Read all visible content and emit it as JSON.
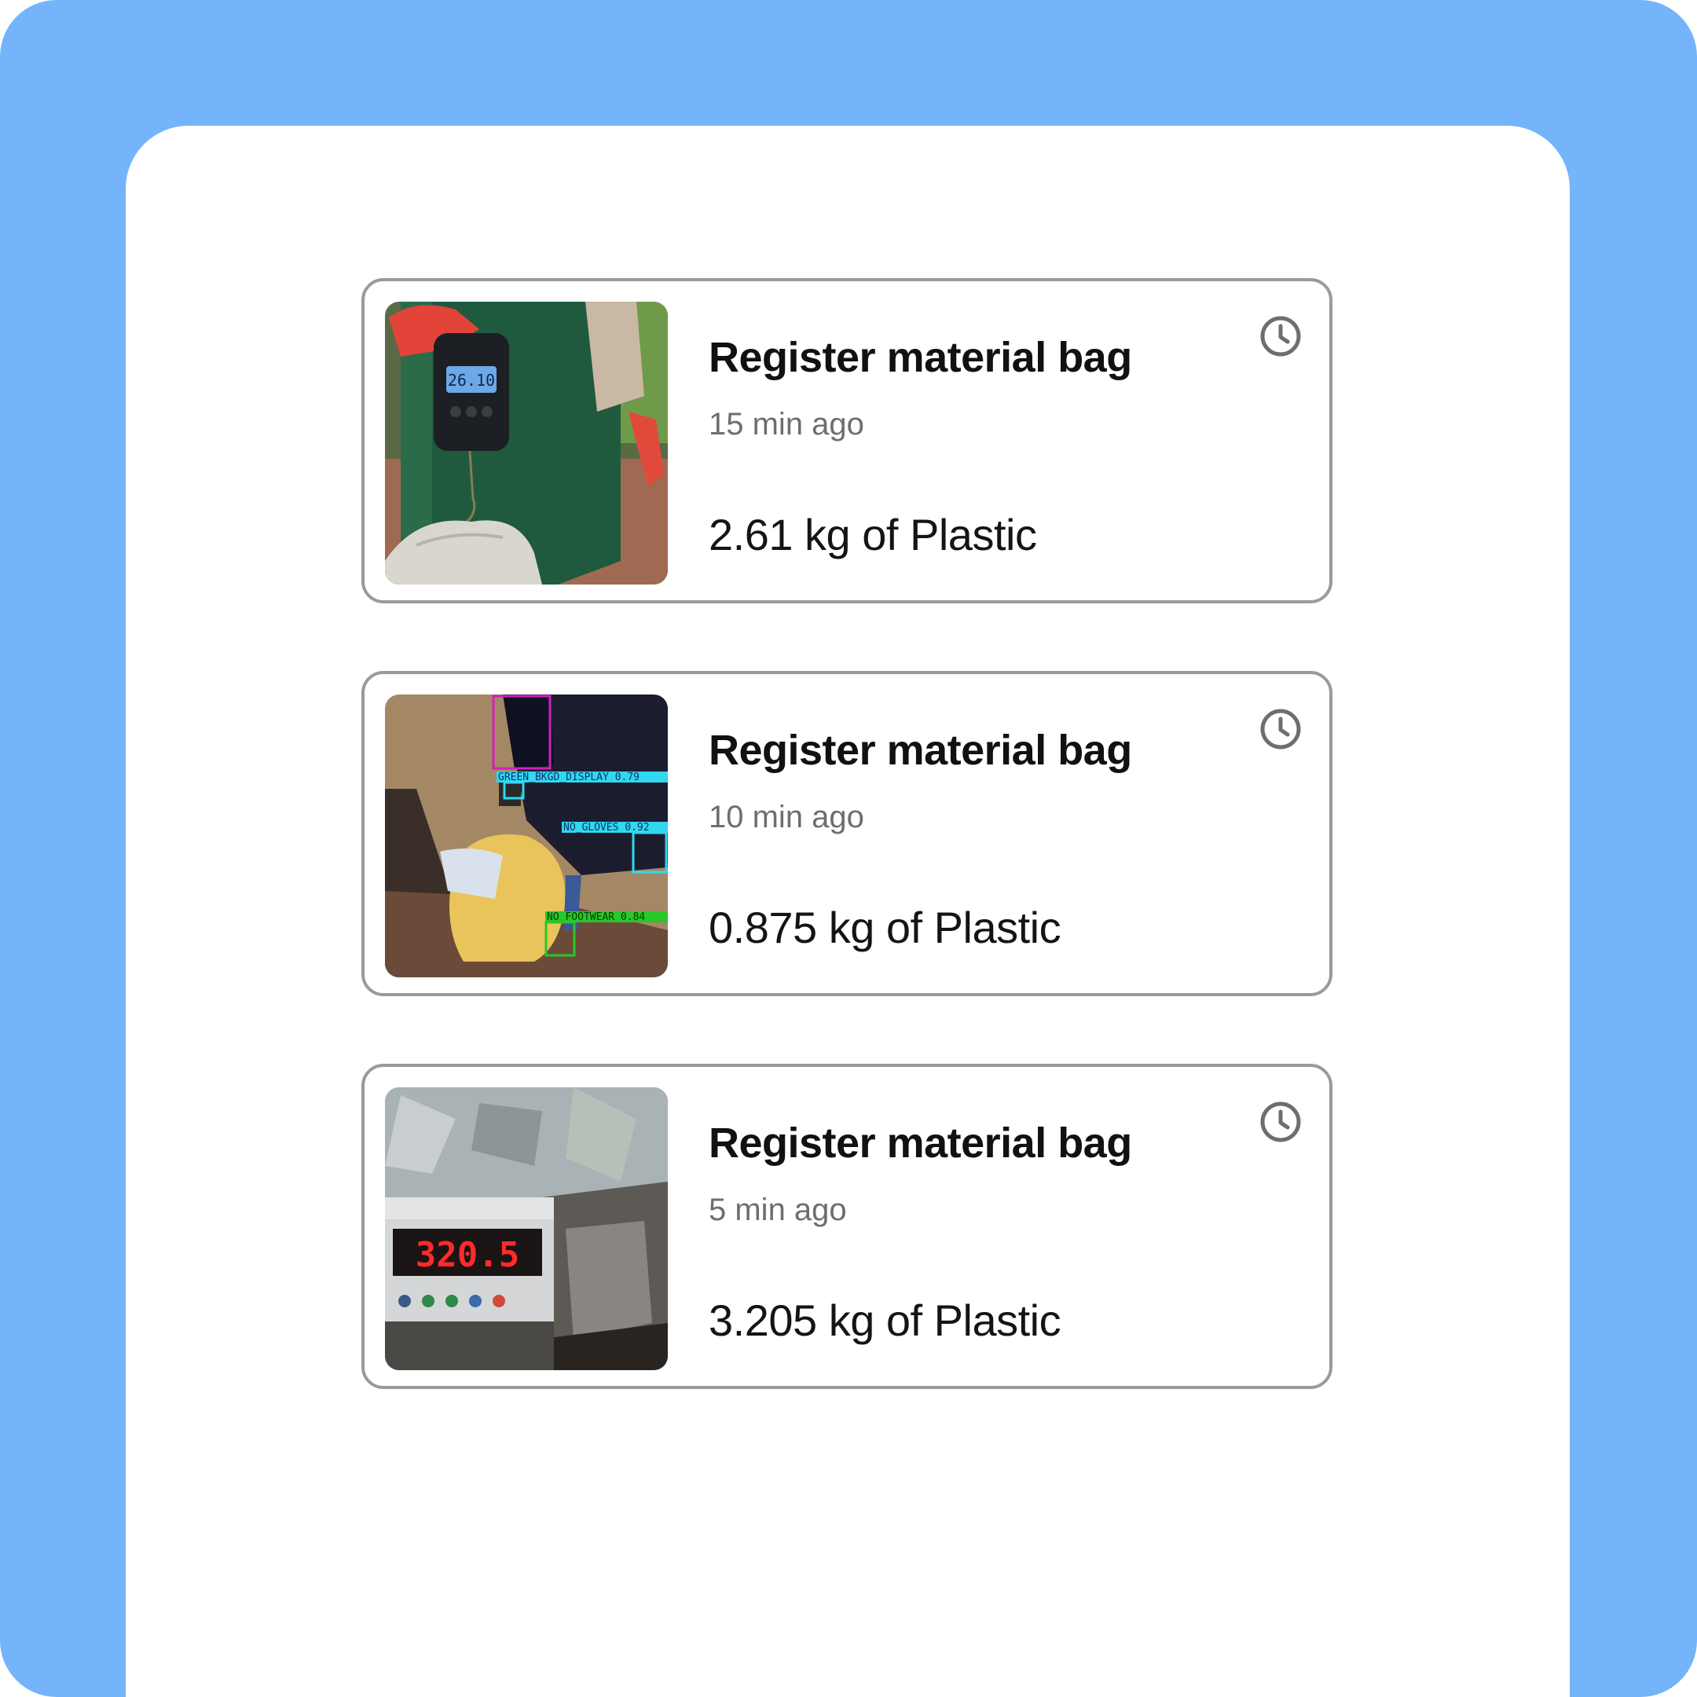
{
  "colors": {
    "background": "#74b4fa",
    "panel": "#ffffff",
    "card_border": "#9a9a9a",
    "icon": "#6e6e6e"
  },
  "activity": [
    {
      "title": "Register material bag",
      "time": "15 min ago",
      "amount": "2.61 kg of Plastic",
      "photo": "hanging-scale-photo",
      "scale_reading": "26.10",
      "icon": "clock-icon"
    },
    {
      "title": "Register material bag",
      "time": "10 min ago",
      "amount": "0.875 kg of Plastic",
      "photo": "detection-photo",
      "detections": [
        "GREEN_BKGD_DISPLAY 0.79",
        "NO_GLOVES 0.92",
        "NO_FOOTWEAR 0.84"
      ],
      "icon": "clock-icon"
    },
    {
      "title": "Register material bag",
      "time": "5 min ago",
      "amount": "3.205 kg of Plastic",
      "photo": "platform-scale-photo",
      "scale_reading": "320.5",
      "icon": "clock-icon"
    }
  ]
}
